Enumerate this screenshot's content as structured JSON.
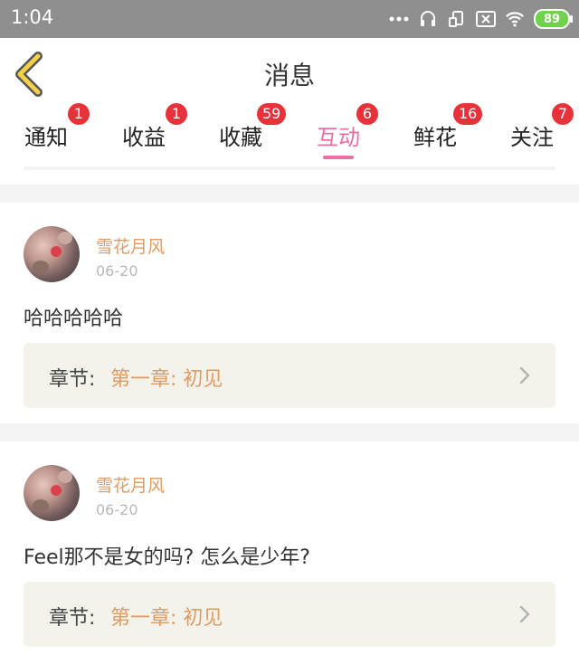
{
  "status_bar": {
    "time": "1:04",
    "battery_level": "89",
    "icons": [
      "more-dots-icon",
      "headset-icon",
      "rotate-lock-icon",
      "sim-off-icon",
      "wifi-icon",
      "battery-icon"
    ]
  },
  "header": {
    "title": "消息",
    "back_icon": "chevron-left-icon"
  },
  "tabs": [
    {
      "label": "通知",
      "badge": "1"
    },
    {
      "label": "收益",
      "badge": "1"
    },
    {
      "label": "收藏",
      "badge": "59"
    },
    {
      "label": "互动",
      "badge": "6",
      "active": true
    },
    {
      "label": "鲜花",
      "badge": "16"
    },
    {
      "label": "关注",
      "badge": "7"
    }
  ],
  "messages": [
    {
      "username": "雪花月风",
      "date": "06-20",
      "comment": "哈哈哈哈哈",
      "chapter_label": "章节:",
      "chapter_name": "第一章: 初见"
    },
    {
      "username": "雪花月风",
      "date": "06-20",
      "comment": "Feel那不是女的吗? 怎么是少年?",
      "chapter_label": "章节:",
      "chapter_name": "第一章: 初见"
    }
  ],
  "colors": {
    "accent_pink": "#ea6fa2",
    "badge_red": "#e8323a",
    "username_orange": "#e29a63",
    "back_arrow_yellow": "#f2d04a"
  }
}
